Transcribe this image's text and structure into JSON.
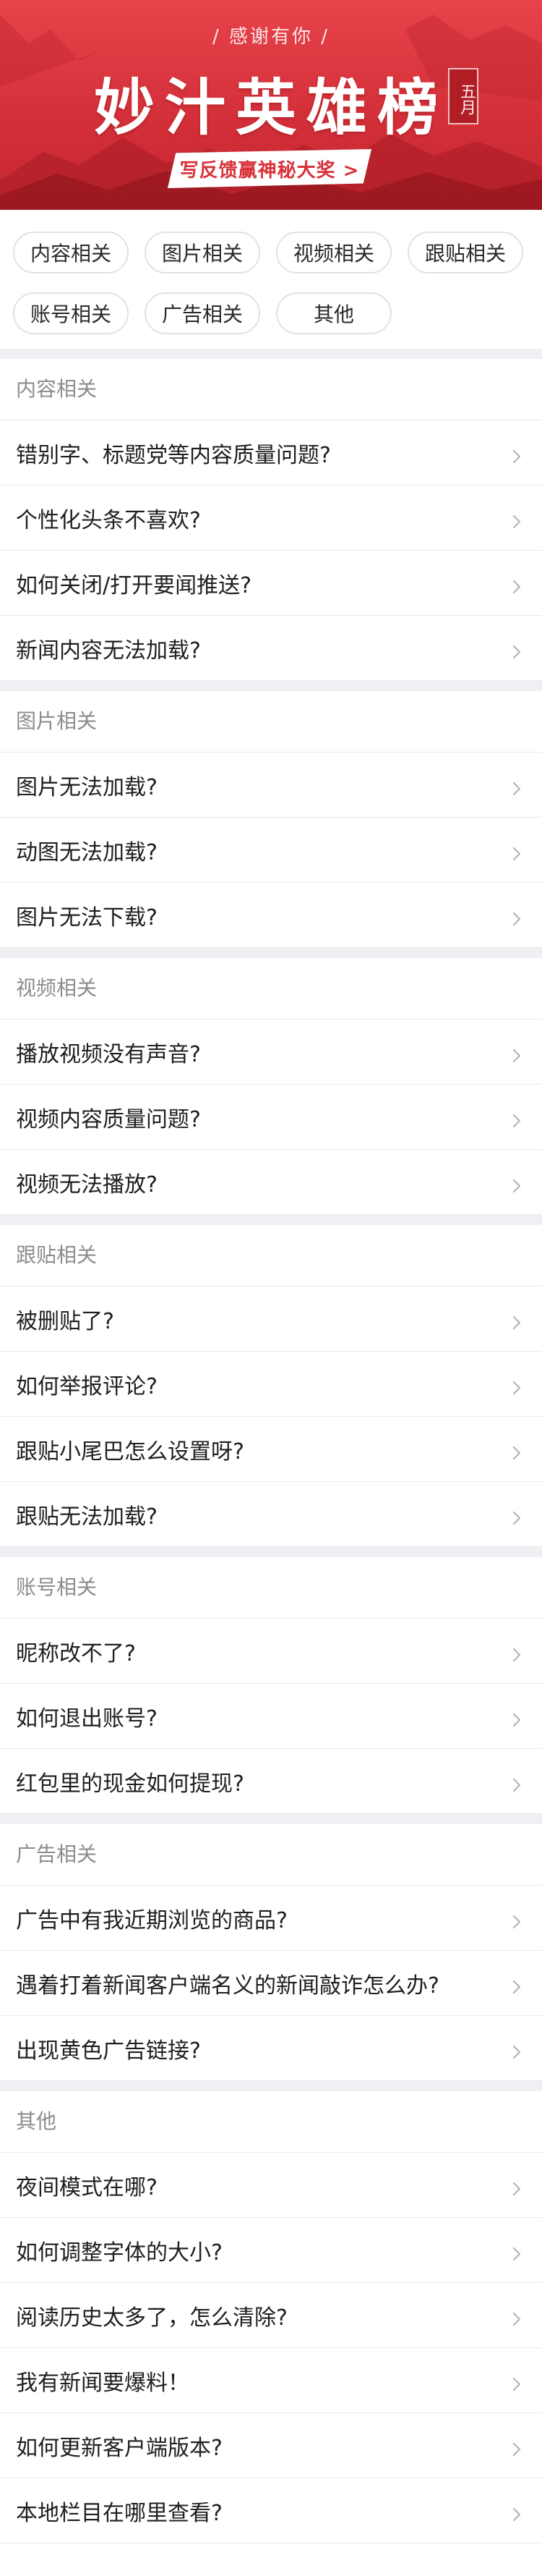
{
  "banner": {
    "thanks": "/ 感谢有你 /",
    "title": "妙汁英雄榜",
    "seal": "五月",
    "cta": "写反馈赢神秘大奖 >",
    "colors": {
      "bg": "#d4303a",
      "cta_text": "#d8323a"
    }
  },
  "categories": [
    "内容相关",
    "图片相关",
    "视频相关",
    "跟贴相关",
    "账号相关",
    "广告相关",
    "其他"
  ],
  "sections": [
    {
      "title": "内容相关",
      "items": [
        "错别字、标题党等内容质量问题?",
        "个性化头条不喜欢?",
        "如何关闭/打开要闻推送?",
        "新闻内容无法加载?"
      ]
    },
    {
      "title": "图片相关",
      "items": [
        "图片无法加载?",
        "动图无法加载?",
        "图片无法下载?"
      ]
    },
    {
      "title": "视频相关",
      "items": [
        "播放视频没有声音?",
        "视频内容质量问题?",
        "视频无法播放?"
      ]
    },
    {
      "title": "跟贴相关",
      "items": [
        "被删贴了?",
        "如何举报评论?",
        "跟贴小尾巴怎么设置呀?",
        "跟贴无法加载?"
      ]
    },
    {
      "title": "账号相关",
      "items": [
        "昵称改不了?",
        "如何退出账号?",
        "红包里的现金如何提现?"
      ]
    },
    {
      "title": "广告相关",
      "items": [
        "广告中有我近期浏览的商品?",
        "遇着打着新闻客户端名义的新闻敲诈怎么办?",
        "出现黄色广告链接?"
      ]
    },
    {
      "title": "其他",
      "items": [
        "夜间模式在哪?",
        "如何调整字体的大小?",
        "阅读历史太多了，怎么清除?",
        "我有新闻要爆料！",
        "如何更新客户端版本?",
        "本地栏目在哪里查看?"
      ]
    }
  ],
  "icons": {
    "row_chevron": "chevron-right-icon"
  }
}
